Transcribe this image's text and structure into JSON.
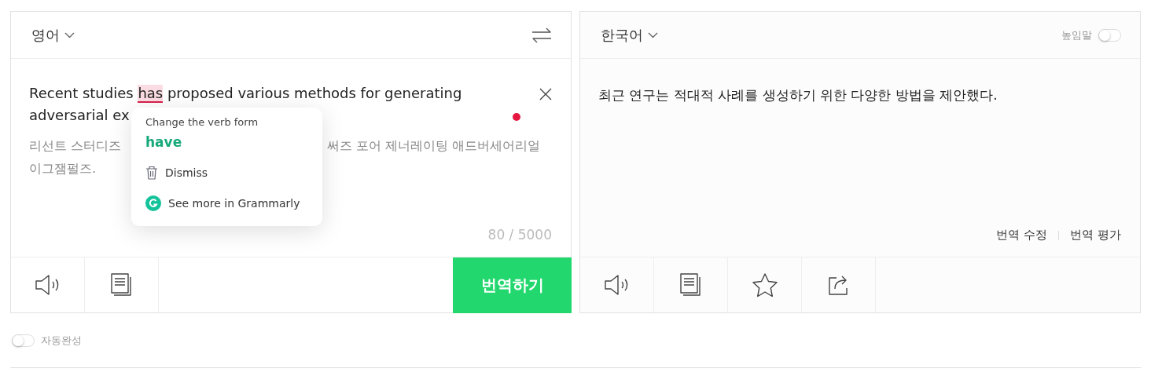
{
  "source_panel": {
    "language": "영어",
    "source": {
      "line_1_before": "Recent studies ",
      "flagged_word": "has",
      "line_1_after": " proposed various methods for generating",
      "line_2": "adversarial ex"
    },
    "pronunciation": {
      "line_1_start": "리선트 스터디즈",
      "line_1_end": "써즈 포어 제너레이팅 애드버세어리얼",
      "line_2": "이그잼펄즈."
    },
    "char_count": "80 / 5000",
    "translate_button": "번역하기"
  },
  "suggestion_popup": {
    "title": "Change the verb form",
    "replacement": "have",
    "actions": [
      {
        "kind": "dismiss",
        "label": "Dismiss"
      },
      {
        "kind": "grammarly",
        "label": "See more in Grammarly"
      }
    ]
  },
  "target_panel": {
    "language": "한국어",
    "honorific": {
      "label": "높임말",
      "on": false
    },
    "translation": "최근 연구는 적대적 사례를 생성하기 위한 다양한 방법을 제안했다.",
    "links": [
      "번역 수정",
      "번역 평가"
    ]
  },
  "autocomplete": {
    "label": "자동완성",
    "on": false
  }
}
